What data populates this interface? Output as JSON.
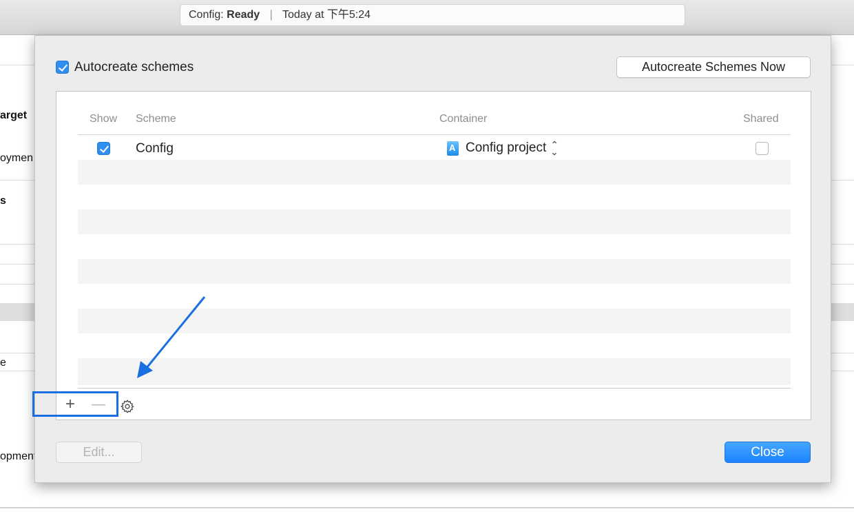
{
  "activity_bar": {
    "project": "Config:",
    "status": "Ready",
    "time": "Today at 下午5:24"
  },
  "background_labels": [
    "arget",
    "oymen",
    "s",
    "e",
    "opment"
  ],
  "sheet": {
    "autocreate_checked": true,
    "autocreate_label": "Autocreate schemes",
    "autocreate_now_label": "Autocreate Schemes Now",
    "table": {
      "columns": [
        "Show",
        "Scheme",
        "Container",
        "Shared"
      ],
      "rows": [
        {
          "show": true,
          "scheme": "Config",
          "container": "Config project",
          "shared": false
        }
      ]
    },
    "controls": {
      "add": "+",
      "remove": "—"
    },
    "edit_label": "Edit...",
    "close_label": "Close"
  },
  "colors": {
    "accent": "#2f8ef0",
    "annotation": "#1a6fe0"
  },
  "icons": [
    "checkbox-checked-icon",
    "project-file-icon",
    "stepper-icon",
    "gear-icon",
    "annotation-arrow-icon"
  ]
}
